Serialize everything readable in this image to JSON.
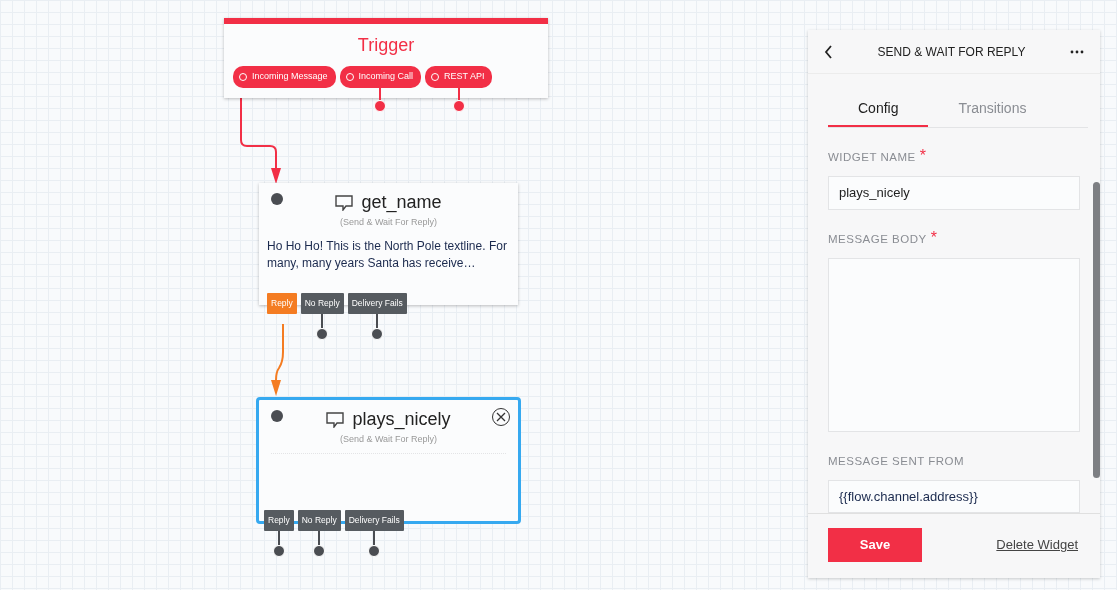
{
  "trigger": {
    "title": "Trigger",
    "ports": [
      {
        "label": "Incoming Message",
        "connected": true
      },
      {
        "label": "Incoming Call",
        "connected": false
      },
      {
        "label": "REST API",
        "connected": false
      }
    ]
  },
  "widgets": [
    {
      "name": "get_name",
      "type_label": "(Send & Wait For Reply)",
      "body": "Ho Ho Ho! This is the North Pole textline. For many, many years Santa has receive…",
      "selected": false,
      "transitions": [
        {
          "label": "Reply",
          "connected": true
        },
        {
          "label": "No Reply",
          "connected": false
        },
        {
          "label": "Delivery Fails",
          "connected": false
        }
      ]
    },
    {
      "name": "plays_nicely",
      "type_label": "(Send & Wait For Reply)",
      "selected": true,
      "transitions": [
        {
          "label": "Reply",
          "connected": false
        },
        {
          "label": "No Reply",
          "connected": false
        },
        {
          "label": "Delivery Fails",
          "connected": false
        }
      ]
    }
  ],
  "panel": {
    "title": "SEND & WAIT FOR REPLY",
    "tabs": [
      {
        "label": "Config",
        "selected": true
      },
      {
        "label": "Transitions",
        "selected": false
      }
    ],
    "fields": [
      {
        "kind": "input",
        "label": "WIDGET NAME",
        "required_mark": "*",
        "value": "plays_nicely"
      },
      {
        "kind": "textarea",
        "label": "MESSAGE BODY",
        "required_mark": "*"
      },
      {
        "kind": "input",
        "label": "MESSAGE SENT FROM",
        "value": "{{flow.channel.address}}"
      }
    ],
    "save": "Save",
    "delete": "Delete Widget"
  }
}
